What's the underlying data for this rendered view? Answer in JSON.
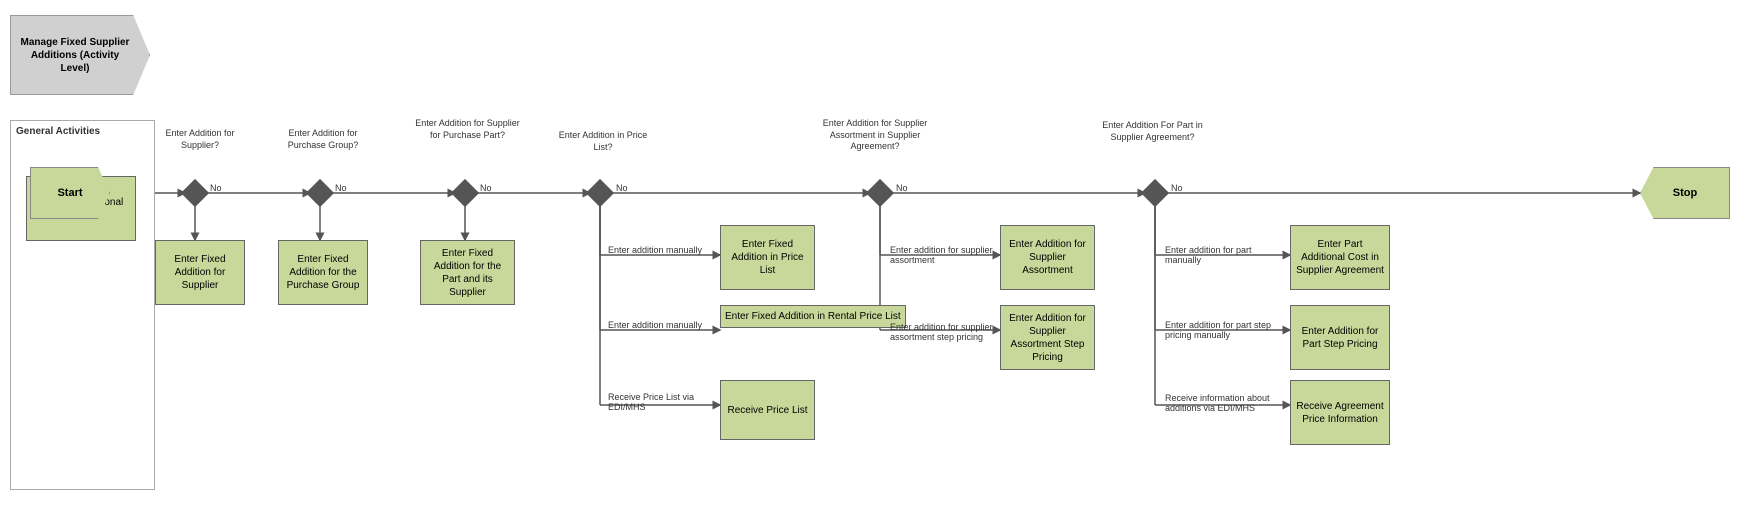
{
  "title": "Manage Fixed Supplier Additions (Activity Level)",
  "start_label": "Start",
  "stop_label": "Stop",
  "general_activities_label": "General Activities",
  "activities": [
    {
      "id": "informational_text",
      "label": "Enter Informational Text"
    },
    {
      "id": "fixed_supplier",
      "label": "Enter Fixed Addition for Supplier"
    },
    {
      "id": "fixed_purchase_group",
      "label": "Enter Fixed Addition for the Purchase Group"
    },
    {
      "id": "fixed_part_supplier",
      "label": "Enter Fixed Addition for the Part and its Supplier"
    },
    {
      "id": "fixed_price_list",
      "label": "Enter Fixed Addition in Price List"
    },
    {
      "id": "fixed_rental_price_list",
      "label": "Enter Fixed Addition in Rental Price List"
    },
    {
      "id": "receive_price_list",
      "label": "Receive Price List"
    },
    {
      "id": "fixed_supplier_assortment",
      "label": "Enter Addition for Supplier Assortment"
    },
    {
      "id": "fixed_assortment_step",
      "label": "Enter Addition for Supplier Assortment Step Pricing"
    },
    {
      "id": "part_additional_cost",
      "label": "Enter Part Additional Cost in Supplier Agreement"
    },
    {
      "id": "part_step_pricing",
      "label": "Enter Addition for Part Step Pricing"
    },
    {
      "id": "receive_agreement_price",
      "label": "Receive Agreement Price Information"
    }
  ],
  "decisions": [
    {
      "id": "d1",
      "label": "Enter Addition for Supplier?"
    },
    {
      "id": "d2",
      "label": "Enter Addition for Purchase Group?"
    },
    {
      "id": "d3",
      "label": "Enter Addition for Supplier for Purchase Part?"
    },
    {
      "id": "d4",
      "label": "Enter Addition in Price List?"
    },
    {
      "id": "d5",
      "label": "Enter Addition for Supplier Assortment in Supplier Agreement?"
    },
    {
      "id": "d6",
      "label": "Enter Addition For Part in Supplier Agreement?"
    }
  ],
  "flow_labels": {
    "no": "No",
    "enter_manually_1": "Enter addition manually",
    "enter_manually_2": "Enter addition manually",
    "receive_pricelist": "Receive Price List via EDI/MHS",
    "enter_assortment": "Enter addition for supplier assortment",
    "enter_assortment_step": "Enter addition for supplier assortment step pricing",
    "enter_part_manually": "Enter addition for part manually",
    "enter_part_step_manually": "Enter addition for part step pricing manually",
    "receive_via_edi": "Receive information about additions via EDI/MHS"
  }
}
